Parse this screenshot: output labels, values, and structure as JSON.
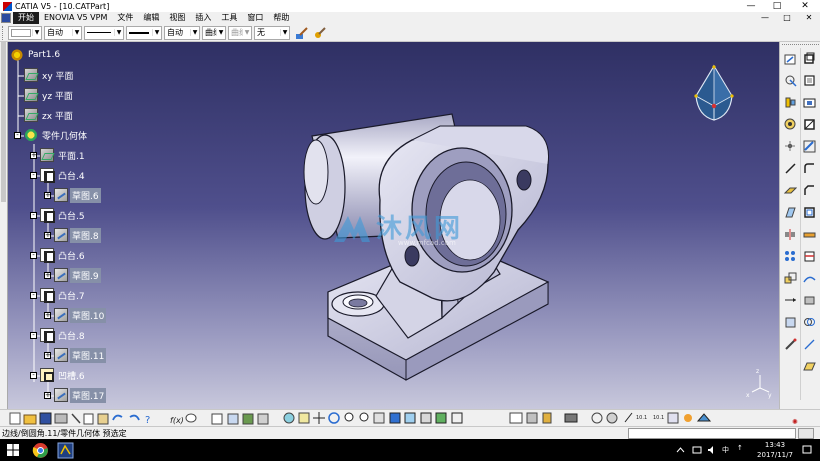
{
  "window": {
    "title": "CATIA V5 - [10.CATPart]",
    "controls": [
      "—",
      "□",
      "✕"
    ]
  },
  "menubar": {
    "items": [
      "开始",
      "ENOVIA V5 VPM",
      "文件",
      "编辑",
      "视图",
      "插入",
      "工具",
      "窗口",
      "帮助"
    ],
    "doc_controls": [
      "—",
      "□",
      "✕"
    ]
  },
  "properties": {
    "color_value": "",
    "transparency_value": "自动",
    "linetype_value": "",
    "linewidth_value": "自动",
    "layer_value": "曲线",
    "filter_value": "曲线",
    "render_value": "无"
  },
  "tree": {
    "root": "Part1.6",
    "planes": [
      "xy 平面",
      "yz 平面",
      "zx 平面"
    ],
    "body": "零件几何体",
    "body_plane": "平面.1",
    "features": [
      {
        "name": "凸台.4",
        "sketch": "草图.6"
      },
      {
        "name": "凸台.5",
        "sketch": "草图.8"
      },
      {
        "name": "凸台.6",
        "sketch": "草图.9"
      },
      {
        "name": "凸台.7",
        "sketch": "草图.10"
      },
      {
        "name": "凸台.8",
        "sketch": "草图.11"
      },
      {
        "name": "凹槽.6",
        "sketch": "草图.17"
      }
    ]
  },
  "watermark": {
    "text": "沐风网",
    "url": "www.mfcad.com"
  },
  "axis_labels": {
    "x": "x",
    "y": "y",
    "z": "z"
  },
  "status": {
    "message": "边线/倒圆角.11/零件几何体 预选定"
  },
  "taskbar": {
    "time": "13:43",
    "date": "2017/11/7",
    "ime": "中",
    "extra": "↑"
  },
  "colors": {
    "viewport_top": "#2f3064",
    "viewport_bottom": "#c8c8dc",
    "part_face": "#dcdcec",
    "edge": "#1a1a2a",
    "compass_blue": "#2b5a90"
  }
}
